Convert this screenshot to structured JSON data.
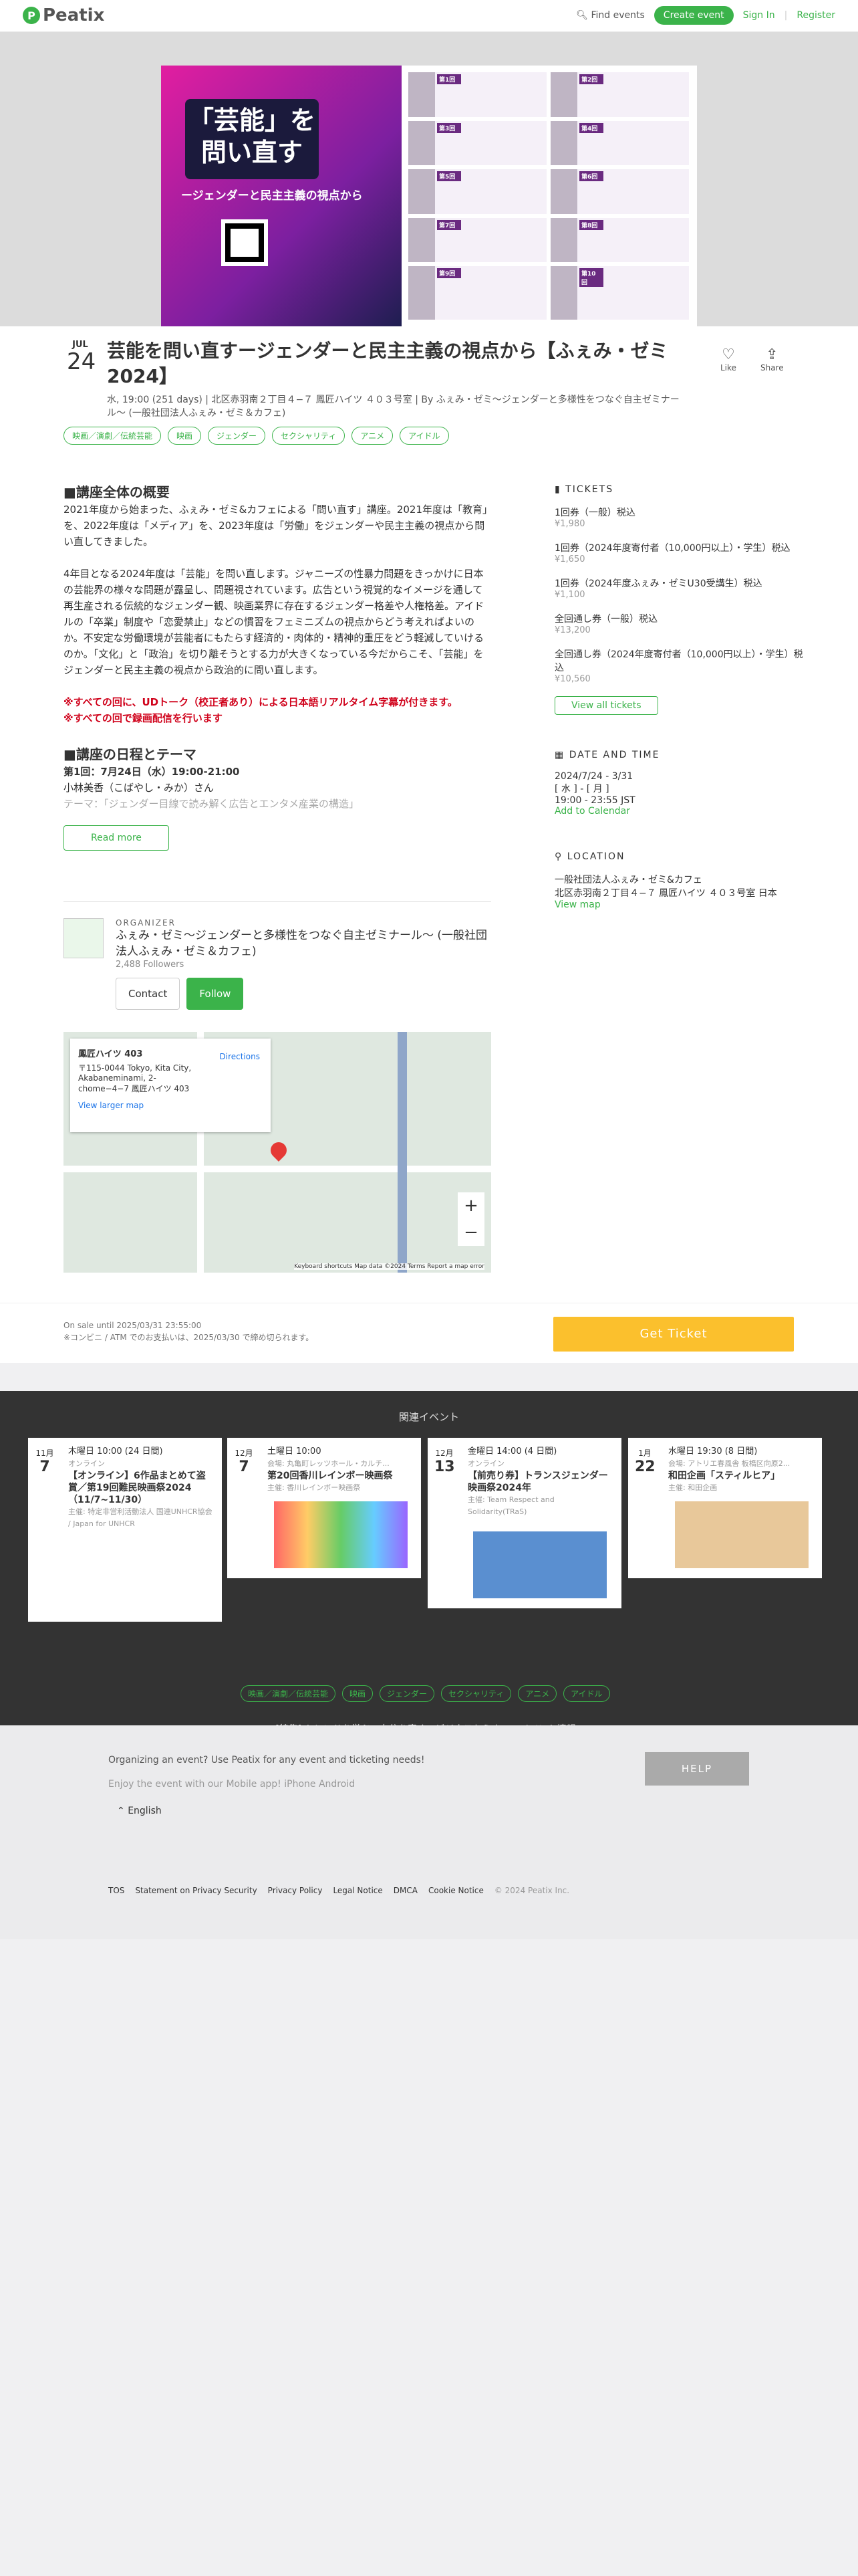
{
  "header": {
    "logo": "Peatix",
    "find": "Find events",
    "create": "Create event",
    "signin": "Sign In",
    "register": "Register"
  },
  "banner": {
    "title": "「芸能」を問い直す",
    "subtitle": "ージェンダーと民主主義の視点から",
    "cells": [
      "第1回",
      "第2回",
      "第3回",
      "第4回",
      "第5回",
      "第6回",
      "第7回",
      "第8回",
      "第9回",
      "第10回"
    ]
  },
  "event": {
    "month": "JUL",
    "day": "24",
    "title": "芸能を問い直すージェンダーと民主主義の視点から【ふぇみ・ゼミ2024】",
    "meta": "水, 19:00 (251 days) | 北区赤羽南２丁目４−７ 鳳匠ハイツ ４０３号室 | By ふぇみ・ゼミ〜ジェンダーと多様性をつなぐ自主ゼミナール〜 (一般社団法人ふぇみ・ゼミ＆カフェ)",
    "like": "Like",
    "share": "Share",
    "tags": [
      "映画／演劇／伝統芸能",
      "映画",
      "ジェンダー",
      "セクシャリティ",
      "アニメ",
      "アイドル"
    ]
  },
  "desc": {
    "h1": "■講座全体の概要",
    "p1": "2021年度から始まった、ふぇみ・ゼミ&カフェによる「問い直す」講座。2021年度は「教育」を、2022年度は「メディア」を、2023年度は「労働」をジェンダーや民主主義の視点から問い直してきました。",
    "p2": "4年目となる2024年度は「芸能」を問い直します。ジャニーズの性暴力問題をきっかけに日本の芸能界の様々な問題が露呈し、問題視されています。広告という視覚的なイメージを通して再生産される伝統的なジェンダー観、映画業界に存在するジェンダー格差や人権格差。アイドルの「卒業」制度や「恋愛禁止」などの慣習をフェミニズムの視点からどう考えればよいのか。不安定な労働環境が芸能者にもたらす経済的・肉体的・精神的重圧をどう軽減していけるのか。「文化」と「政治」を切り離そうとする力が大きくなっている今だからこそ、「芸能」をジェンダーと民主主義の視点から政治的に問い直します。",
    "r1": "※すべての回に、UDトーク（校正者あり）による日本語リアルタイム字幕が付きます。",
    "r2": "※すべての回で録画配信を行います",
    "h2": "■講座の日程とテーマ",
    "s1": "第1回：7月24日（水）19:00-21:00",
    "s2": "小林美香（こばやし・みか）さん",
    "s3": "テーマ：「ジェンダー目線で読み解く広告とエンタメ産業の構造」",
    "readmore": "Read more"
  },
  "tickets": {
    "heading": "TICKETS",
    "items": [
      {
        "name": "1回券（一般）税込",
        "price": "¥1,980"
      },
      {
        "name": "1回券（2024年度寄付者（10,000円以上）・学生）税込",
        "price": "¥1,650"
      },
      {
        "name": "1回券（2024年度ふぇみ・ゼミU30受講生）税込",
        "price": "¥1,100"
      },
      {
        "name": "全回通し券（一般）税込",
        "price": "¥13,200"
      },
      {
        "name": "全回通し券（2024年度寄付者（10,000円以上）・学生）税込",
        "price": "¥10,560"
      }
    ],
    "view_all": "View all tickets"
  },
  "datetime": {
    "heading": "DATE AND TIME",
    "range": "2024/7/24 - 3/31",
    "days": "[ 水 ] - [ 月 ]",
    "time": "19:00 - 23:55 JST",
    "calendar": "Add to Calendar"
  },
  "location": {
    "heading": "LOCATION",
    "name": "一般社団法人ふぇみ・ゼミ&カフェ",
    "addr": "北区赤羽南２丁目４−７ 鳳匠ハイツ ４０３号室 日本",
    "map": "View map"
  },
  "organizer": {
    "label": "ORGANIZER",
    "name": "ふぇみ・ゼミ〜ジェンダーと多様性をつなぐ自主ゼミナール〜 (一般社団法人ふぇみ・ゼミ＆カフェ)",
    "followers": "2,488 Followers",
    "contact": "Contact",
    "follow": "Follow"
  },
  "mapcard": {
    "title": "鳳匠ハイツ 403",
    "addr": "〒115-0044 Tokyo, Kita City, Akabaneminami, 2-chome−4−7 鳳匠ハイツ 403",
    "dir": "Directions",
    "larger": "View larger map",
    "footer": "Keyboard shortcuts   Map data ©2024   Terms   Report a map error"
  },
  "sale": {
    "l1": "On sale until 2025/03/31 23:55:00",
    "l2": "※コンビニ / ATM でのお支払いは、2025/03/30 で締め切られます。",
    "btn": "Get Ticket"
  },
  "related": {
    "heading": "関連イベント",
    "cards": [
      {
        "m": "11月",
        "d": "7",
        "date": "木曜日 10:00 (24 日間)",
        "mode": "オンライン",
        "title": "【オンライン】6作品まとめて盗賞／第19回難民映画祭2024（11/7~11/30）",
        "host": "主催: 特定非営利活動法人 国連UNHCR協会 / Japan for UNHCR"
      },
      {
        "m": "12月",
        "d": "7",
        "date": "土曜日 10:00",
        "mode": "会場: 丸亀町レッツホール・カルチ...",
        "title": "第20回香川レインボー映画祭",
        "host": "主催: 香川レインボー映画祭"
      },
      {
        "m": "12月",
        "d": "13",
        "date": "金曜日 14:00 (4 日間)",
        "mode": "オンライン",
        "title": "【前売り券】トランスジェンダー映画祭2024年",
        "host": "主催: Team Respect and Solidarity(TRaS)"
      },
      {
        "m": "1月",
        "d": "22",
        "date": "水曜日 19:30 (8 日間)",
        "mode": "会場: アトリエ春風舎 板橋区向原2...",
        "title": "和田企画「スティルヒア」",
        "host": "主催: 和田企画"
      }
    ],
    "tags": [
      "映画／演劇／伝統芸能",
      "映画",
      "ジェンダー",
      "セクシャリティ",
      "アニメ",
      "アイドル"
    ],
    "special": "[特集] トレンドを学ぶ、自分を磨く。ビジネスセミナー・イベント情報 ›"
  },
  "footer": {
    "l1": "Organizing an event? Use Peatix for any event and ticketing needs!",
    "l2": "Enjoy the event with our Mobile app! iPhone Android",
    "help": "HELP",
    "lang": "English",
    "links": [
      "TOS",
      "Statement on Privacy Security",
      "Privacy Policy",
      "Legal Notice",
      "DMCA",
      "Cookie Notice",
      "© 2024 Peatix Inc."
    ]
  }
}
